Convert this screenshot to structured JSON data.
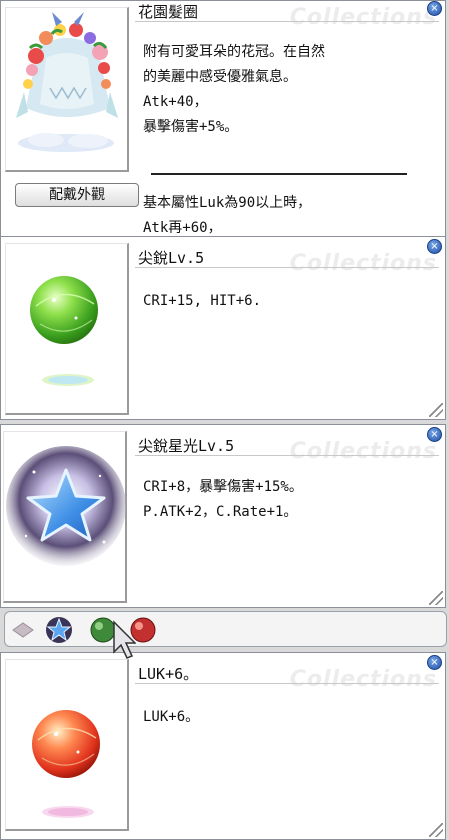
{
  "watermark": "Collections",
  "hat": {
    "name": "花園髮圈",
    "desc": [
      "附有可愛耳朵的花冠。在自然",
      "的美麗中感受優雅氣息。",
      "Atk+40，",
      "暴擊傷害+5%。"
    ],
    "desc2": [
      "基本屬性Luk為90以上時，",
      "Atk再+60，"
    ],
    "button": "配戴外觀",
    "icon": "flower-crown-icon"
  },
  "card1": {
    "name": "尖銳Lv.5",
    "desc": [
      "CRI+15, HIT+6."
    ],
    "icon": "green-orb-icon",
    "accent": "#6cc43a"
  },
  "card2": {
    "name": "尖銳星光Lv.5",
    "desc": [
      "CRI+8，暴擊傷害+15%。",
      "P.ATK+2，C.Rate+1。"
    ],
    "icon": "blue-star-icon",
    "accent": "#4a8ee8"
  },
  "sockets": {
    "items": [
      "gray-diamond-icon",
      "blue-star-icon",
      "green-orb-icon",
      "red-orb-icon"
    ]
  },
  "card3": {
    "name": "LUK+6。",
    "desc": [
      "LUK+6。"
    ],
    "icon": "red-orb-icon",
    "accent": "#e8442a"
  }
}
